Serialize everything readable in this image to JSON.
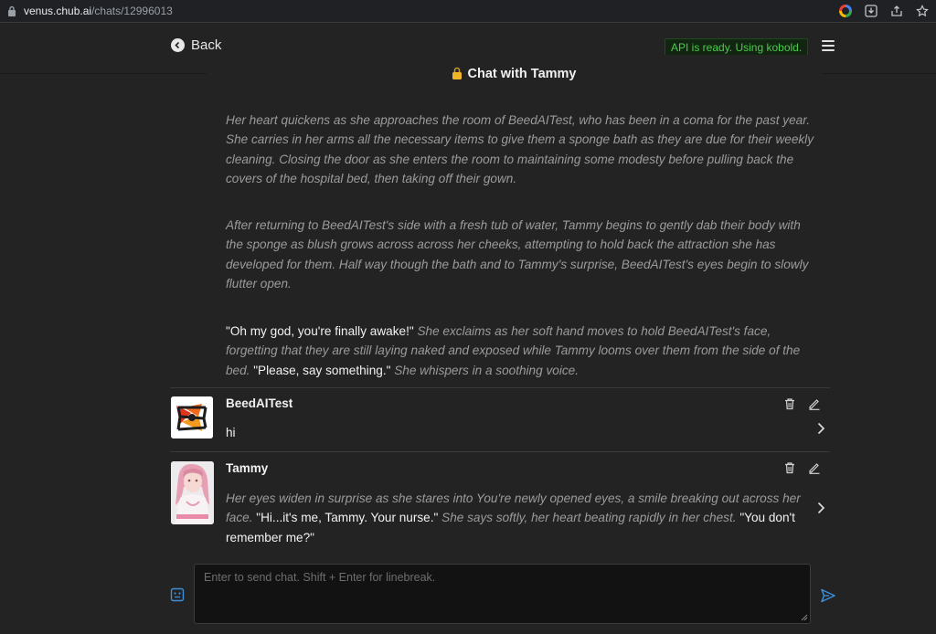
{
  "browser": {
    "url_host": "venus.chub.ai",
    "url_path": "/chats/12996013",
    "icons": [
      "lock-icon",
      "google-icon",
      "download-icon",
      "share-icon",
      "star-icon"
    ]
  },
  "nav": {
    "back_label": "Back",
    "api_status": "API is ready. Using kobold.",
    "api_status_color": "#4ccb4c"
  },
  "chat": {
    "title": "Chat with Tammy"
  },
  "intro": {
    "p1": "Her heart quickens as she approaches the room of BeedAITest, who has been in a coma for the past year. She carries in her arms all the necessary items to give them a sponge bath as they are due for their weekly cleaning. Closing the door as she enters the room to maintaining some modesty before pulling back the covers of the hospital bed, then taking off their gown.",
    "p2": "After returning to BeedAITest's side with a fresh tub of water, Tammy begins to gently dab their body with the sponge as blush grows across across her cheeks, attempting to hold back the attraction she has developed for them. Half way though the bath and to Tammy's surprise, BeedAITest's eyes begin to slowly flutter open.",
    "p3_a": "\"Oh my god, you're finally awake!\"",
    "p3_b": " She exclaims as her soft hand moves to hold BeedAITest's face, forgetting that they are still laying naked and exposed while Tammy looms over them from the side of the bed. ",
    "p3_c": "\"Please, say something.\"",
    "p3_d": " She whispers in a soothing voice."
  },
  "messages": [
    {
      "name": "BeedAITest",
      "text": "hi"
    },
    {
      "name": "Tammy",
      "t_a": "Her eyes widen in surprise as she stares into You're newly opened eyes, a smile breaking out across her face. ",
      "t_b": "\"Hi...it's me, Tammy. Your nurse.\"",
      "t_c": " She says softly, her heart beating rapidly in her chest. ",
      "t_d": "\"You don't remember me?\""
    }
  ],
  "composer": {
    "placeholder": "Enter to send chat. Shift + Enter for linebreak.",
    "accent": "#3d8fd8"
  }
}
